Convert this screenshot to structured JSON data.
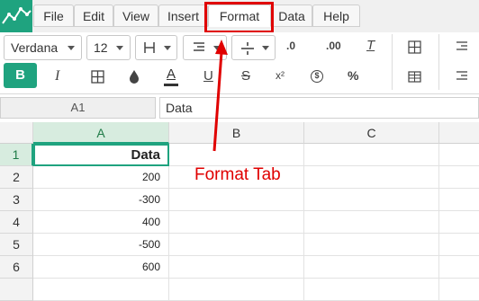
{
  "menu": {
    "items": [
      {
        "label": "File"
      },
      {
        "label": "Edit"
      },
      {
        "label": "View"
      },
      {
        "label": "Insert"
      },
      {
        "label": "Format"
      },
      {
        "label": "Data"
      },
      {
        "label": "Help"
      }
    ],
    "active": "Format"
  },
  "toolbar": {
    "font_family": "Verdana",
    "font_size": "12",
    "bold": "B",
    "italic": "I",
    "underline": "U",
    "strikethrough": "S",
    "text_color": "A",
    "superscript": "x²",
    "currency": "$",
    "percent": "%",
    "decrease_decimal": ".0",
    "increase_decimal": ".00",
    "clear_format": "T",
    "accent_color": "#1fa37f"
  },
  "namebox": {
    "value": "A1"
  },
  "formula": {
    "value": "Data"
  },
  "columns": [
    "A",
    "B",
    "C"
  ],
  "rows": [
    "1",
    "2",
    "3",
    "4",
    "5",
    "6"
  ],
  "cells": {
    "a1": "Data",
    "a2": "200",
    "a3": "-300",
    "a4": "400",
    "a5": "-500",
    "a6": "600"
  },
  "annotation": {
    "text": "Format Tab",
    "color": "#e00000"
  }
}
